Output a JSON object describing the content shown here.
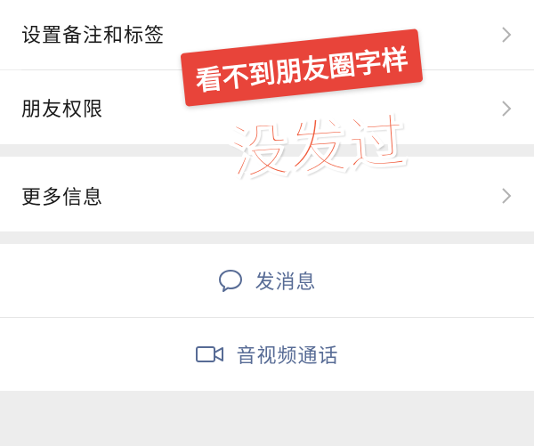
{
  "rows": [
    {
      "label": "设置备注和标签"
    },
    {
      "label": "朋友权限"
    },
    {
      "label": "更多信息"
    }
  ],
  "actions": {
    "message_label": "发消息",
    "call_label": "音视频通话"
  },
  "overlay": {
    "banner_text": "看不到朋友圈字样",
    "big_text": "没发过"
  },
  "icons": {
    "chevron": "chevron-right-icon",
    "message": "chat-bubble-icon",
    "video": "video-camera-icon"
  },
  "colors": {
    "link_blue": "#576b95",
    "banner_red": "#e8443a",
    "big_text_red": "#f05a3a"
  }
}
